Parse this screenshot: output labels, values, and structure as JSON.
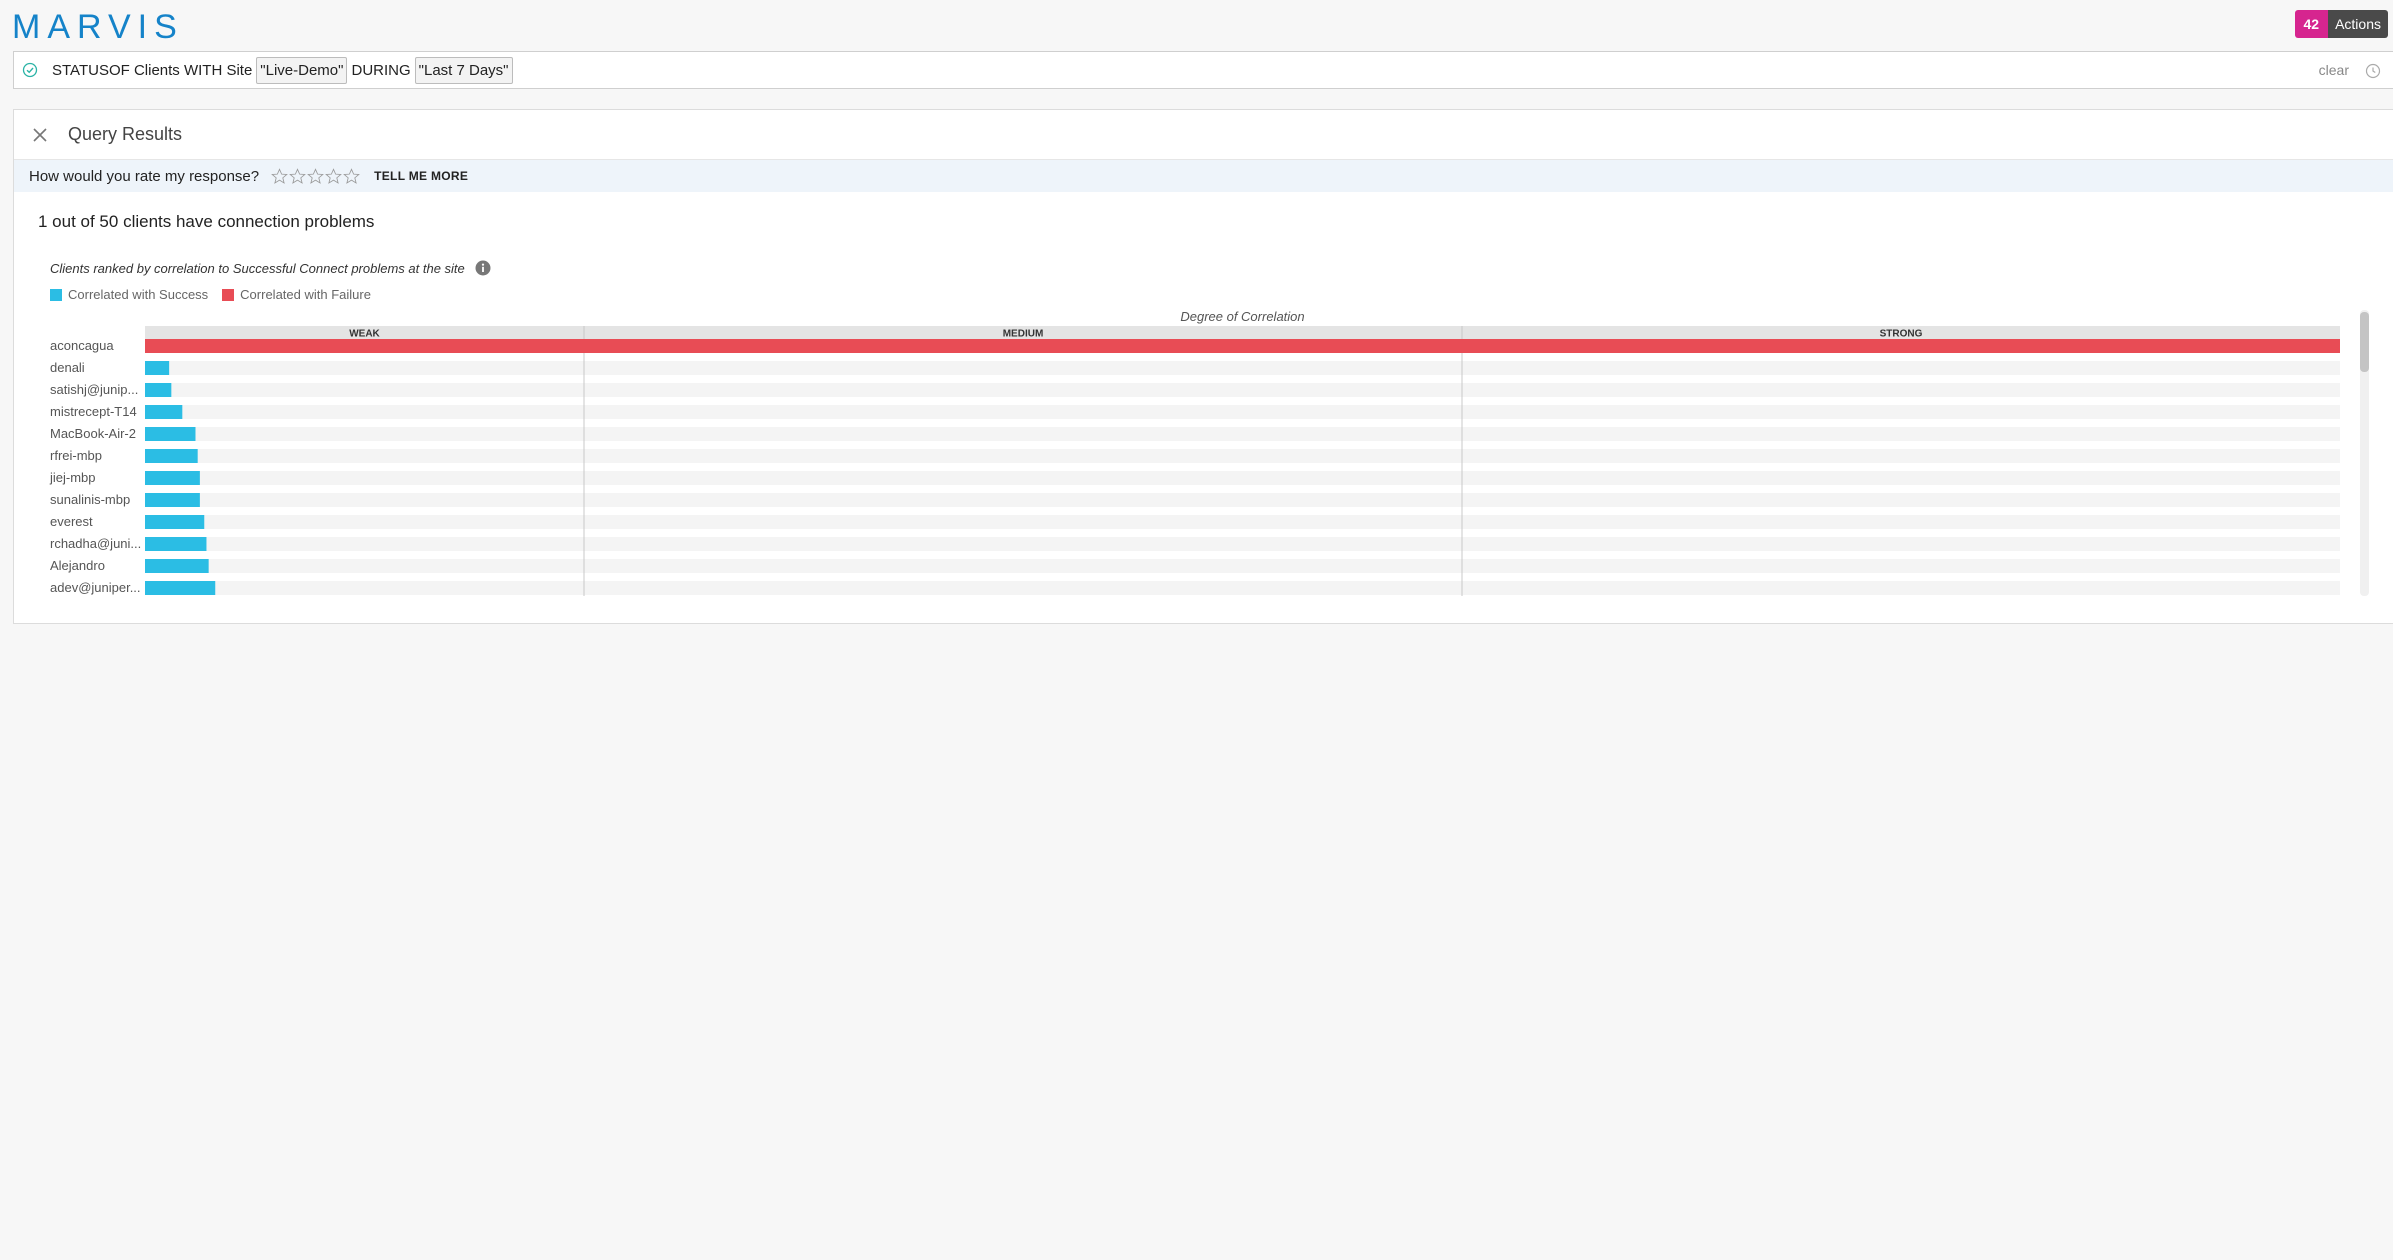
{
  "header": {
    "logo": "MARVIS",
    "actions_count": "42",
    "actions_label": "Actions"
  },
  "query": {
    "prefix": "STATUSOF Clients WITH Site",
    "site_token": "\"Live-Demo\"",
    "middle": "DURING",
    "time_token": "\"Last 7 Days\"",
    "clear_label": "clear"
  },
  "panel": {
    "title": "Query Results",
    "rating_prompt": "How would you rate my response?",
    "tell_more": "TELL ME MORE",
    "summary": "1 out of 50 clients have connection problems",
    "subtitle": "Clients ranked by correlation to Successful Connect problems at the site",
    "legend": {
      "success": "Correlated with Success",
      "failure": "Correlated with Failure"
    }
  },
  "colors": {
    "success": "#2bbde4",
    "failure": "#e84c55",
    "logo": "#1583c9",
    "actions_badge": "#d6258f"
  },
  "chart_data": {
    "type": "bar",
    "orientation": "horizontal",
    "title": "Degree of Correlation",
    "bands": [
      "WEAK",
      "MEDIUM",
      "STRONG"
    ],
    "band_bounds": [
      0.2,
      0.6,
      1.0
    ],
    "xlim": [
      0,
      1
    ],
    "categories": [
      "aconcagua",
      "denali",
      "satishj@junip...",
      "mistrecept-T14",
      "MacBook-Air-2",
      "rfrei-mbp",
      "jiej-mbp",
      "sunalinis-mbp",
      "everest",
      "rchadha@juni...",
      "Alejandro",
      "adev@juniper..."
    ],
    "values": [
      1.0,
      0.011,
      0.012,
      0.017,
      0.023,
      0.024,
      0.025,
      0.025,
      0.027,
      0.028,
      0.029,
      0.032
    ],
    "correlation": [
      "failure",
      "success",
      "success",
      "success",
      "success",
      "success",
      "success",
      "success",
      "success",
      "success",
      "success",
      "success"
    ]
  }
}
